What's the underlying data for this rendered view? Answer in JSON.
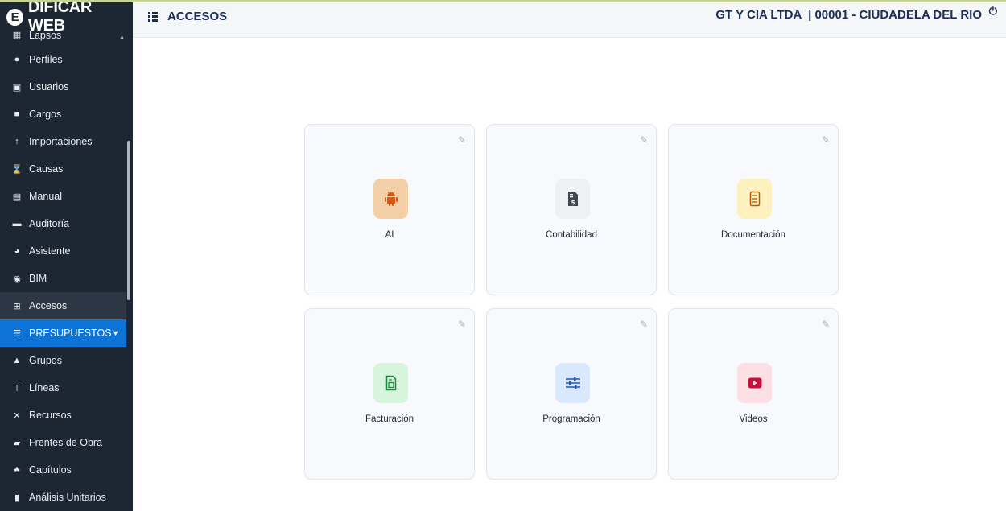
{
  "brand": {
    "logo_letter": "E",
    "name": "DIFICAR WEB"
  },
  "sidebar": {
    "items": [
      {
        "label": "Lapsos",
        "icon": "calendar-icon"
      },
      {
        "label": "Perfiles",
        "icon": "user-icon"
      },
      {
        "label": "Usuarios",
        "icon": "id-card-icon"
      },
      {
        "label": "Cargos",
        "icon": "briefcase-icon"
      },
      {
        "label": "Importaciones",
        "icon": "arrow-up-icon"
      },
      {
        "label": "Causas",
        "icon": "hourglass-icon"
      },
      {
        "label": "Manual",
        "icon": "book-icon"
      },
      {
        "label": "Auditoría",
        "icon": "archive-icon"
      },
      {
        "label": "Asistente",
        "icon": "chat-icon"
      },
      {
        "label": "BIM",
        "icon": "cube-icon"
      },
      {
        "label": "Accesos",
        "icon": "apps-icon"
      },
      {
        "label": "PRESUPUESTOS",
        "icon": "list-icon"
      },
      {
        "label": "Grupos",
        "icon": "group-icon"
      },
      {
        "label": "Líneas",
        "icon": "hierarchy-icon"
      },
      {
        "label": "Recursos",
        "icon": "tools-icon"
      },
      {
        "label": "Frentes de Obra",
        "icon": "folder-icon"
      },
      {
        "label": "Capítulos",
        "icon": "sitemap-icon"
      },
      {
        "label": "Análisis Unitarios",
        "icon": "bookmark-icon"
      }
    ]
  },
  "header": {
    "title": "ACCESOS",
    "company": "GT Y CIA LTDA  | 00001 - CIUDADELA DEL RIO",
    "power_glyph": "⏻"
  },
  "cards": [
    {
      "label": "AI",
      "icon": "android-icon",
      "tile_bg": "#f3cfa8",
      "icon_color": "#d9570e"
    },
    {
      "label": "Contabilidad",
      "icon": "invoice-dollar-icon",
      "tile_bg": "#eef0f4",
      "icon_color": "#3f4650"
    },
    {
      "label": "Documentación",
      "icon": "document-icon",
      "tile_bg": "#fdf1bf",
      "icon_color": "#b55d0a"
    },
    {
      "label": "Facturación",
      "icon": "receipt-icon",
      "tile_bg": "#d7f5dd",
      "icon_color": "#178a3c"
    },
    {
      "label": "Programación",
      "icon": "sliders-icon",
      "tile_bg": "#d9e8fd",
      "icon_color": "#1f56c5"
    },
    {
      "label": "Videos",
      "icon": "youtube-icon",
      "tile_bg": "#fddfe6",
      "icon_color": "#c8103a"
    }
  ],
  "colors": {
    "sidebar_bg": "#1d2633",
    "section_highlight": "#0e73d6",
    "header_text": "#1a2d5c"
  }
}
